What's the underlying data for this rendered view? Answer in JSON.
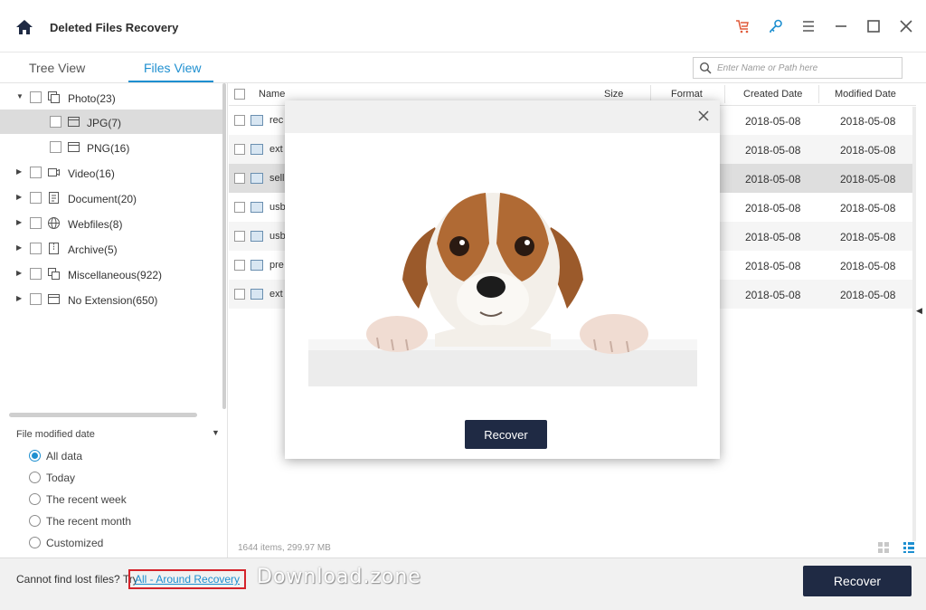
{
  "app": {
    "title": "Deleted Files Recovery"
  },
  "toolbar": {
    "icons": [
      "home-icon",
      "cart-icon",
      "key-icon",
      "menu-icon",
      "minimize-icon",
      "maximize-icon",
      "close-icon"
    ],
    "cart_color": "#e05a3a",
    "key_color": "#1e8fd0"
  },
  "tabs": [
    {
      "label": "Tree View",
      "active": false
    },
    {
      "label": "Files View",
      "active": true
    }
  ],
  "search": {
    "placeholder": "Enter Name or Path here"
  },
  "tree": {
    "items": [
      {
        "label": "Photo(23)",
        "expanded": true,
        "icon": "photo-folder-icon"
      },
      {
        "label": "JPG(7)",
        "child": true,
        "selected": true,
        "icon": "folder-icon"
      },
      {
        "label": "PNG(16)",
        "child": true,
        "icon": "folder-icon"
      },
      {
        "label": "Video(16)",
        "icon": "video-icon"
      },
      {
        "label": "Document(20)",
        "icon": "document-icon"
      },
      {
        "label": "Webfiles(8)",
        "icon": "globe-icon"
      },
      {
        "label": "Archive(5)",
        "icon": "archive-icon"
      },
      {
        "label": "Miscellaneous(922)",
        "icon": "misc-icon"
      },
      {
        "label": "No Extension(650)",
        "icon": "no-extension-icon"
      }
    ]
  },
  "filter": {
    "title": "File modified date",
    "options": [
      {
        "label": "All data",
        "checked": true
      },
      {
        "label": "Today",
        "checked": false
      },
      {
        "label": "The recent week",
        "checked": false
      },
      {
        "label": "The recent month",
        "checked": false
      },
      {
        "label": "Customized",
        "checked": false
      }
    ]
  },
  "table": {
    "headers": {
      "name": "Name",
      "size": "Size",
      "format": "Format",
      "created": "Created Date",
      "modified": "Modified Date"
    },
    "rows": [
      {
        "name": "rec",
        "created": "2018-05-08",
        "modified": "2018-05-08"
      },
      {
        "name": "ext",
        "created": "2018-05-08",
        "modified": "2018-05-08"
      },
      {
        "name": "sell",
        "created": "2018-05-08",
        "modified": "2018-05-08"
      },
      {
        "name": "usb",
        "created": "2018-05-08",
        "modified": "2018-05-08"
      },
      {
        "name": "usb",
        "created": "2018-05-08",
        "modified": "2018-05-08"
      },
      {
        "name": "pre",
        "created": "2018-05-08",
        "modified": "2018-05-08"
      },
      {
        "name": "ext",
        "created": "2018-05-08",
        "modified": "2018-05-08"
      }
    ],
    "status": "1644 items, 299.97 MB"
  },
  "preview_modal": {
    "recover_label": "Recover"
  },
  "bottom": {
    "prompt": "Cannot find lost files? Try",
    "link": "All - Around Recovery",
    "recover_label": "Recover",
    "watermark": "Download.zone"
  },
  "colors": {
    "accent": "#1e8fd0",
    "primary_button": "#1f2a44",
    "link_highlight": "#d4232a"
  }
}
